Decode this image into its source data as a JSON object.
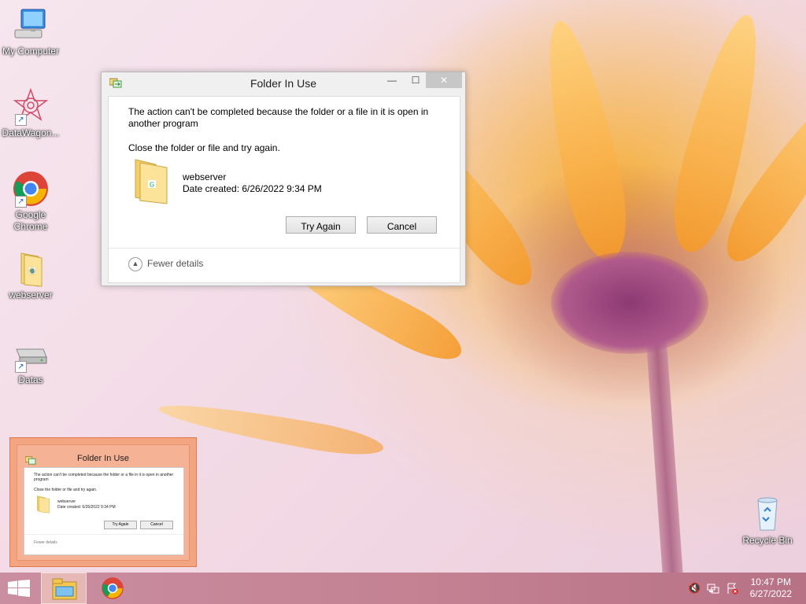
{
  "desktop": {
    "icons": [
      {
        "label": "My Computer",
        "icon": "computer-icon"
      },
      {
        "label": "DataWagon...",
        "icon": "datawagon-icon"
      },
      {
        "label": "Google Chrome",
        "icon": "chrome-icon"
      },
      {
        "label": "webserver",
        "icon": "folder-icon"
      },
      {
        "label": "Datas",
        "icon": "drive-icon"
      },
      {
        "label": "Recycle Bin",
        "icon": "recycle-bin-icon"
      }
    ]
  },
  "dialog": {
    "title": "Folder In Use",
    "message": "The action can't be completed because the folder or a file in it is open in another program",
    "instruction": "Close the folder or file and try again.",
    "file_name": "webserver",
    "file_date": "Date created: 6/26/2022 9:34 PM",
    "try_again_label": "Try Again",
    "cancel_label": "Cancel",
    "fewer_details_label": "Fewer details",
    "controls": {
      "minimize": "—",
      "maximize": "☐",
      "close": "✕"
    }
  },
  "thumbnail": {
    "title": "Folder In Use",
    "message": "The action can't be completed because the folder or a file in it is open in another program",
    "instruction": "Close the folder or file and try again.",
    "file_name": "webserver",
    "file_date": "Date created: 6/26/2022 9:34 PM",
    "try_again_label": "Try Again",
    "cancel_label": "Cancel",
    "fewer_details_label": "Fewer details"
  },
  "taskbar": {
    "time": "10:47 PM",
    "date": "6/27/2022",
    "apps": [
      "file-explorer-icon",
      "chrome-icon"
    ],
    "tray": [
      "volume-muted-icon",
      "network-icon",
      "action-center-flag-icon"
    ]
  },
  "colors": {
    "taskbar": "#c48293",
    "thumbnail_highlight": "#f3a582",
    "dialog_bg": "#f0f0f0"
  }
}
